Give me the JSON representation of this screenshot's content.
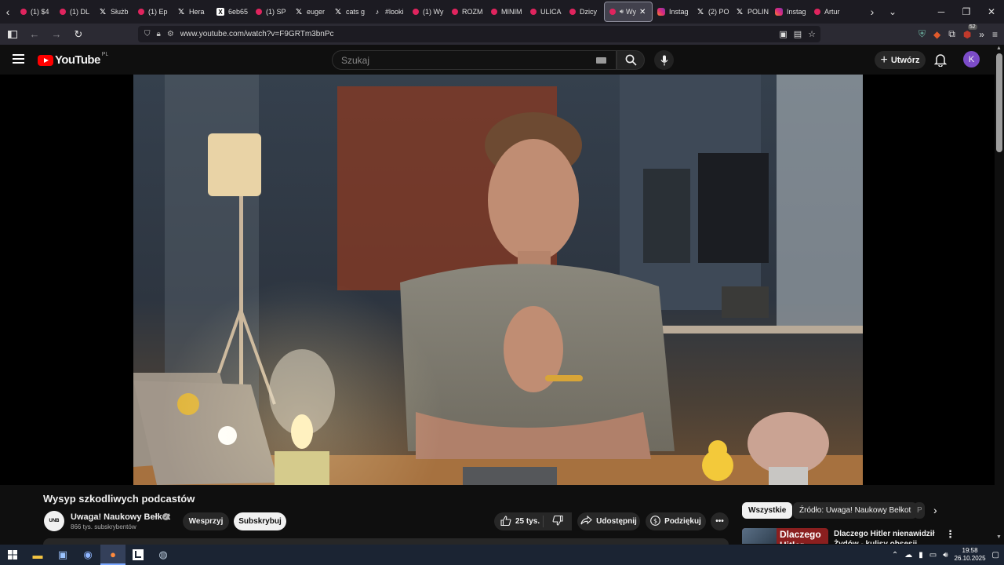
{
  "browser": {
    "tabs": [
      {
        "label": "(1) $4",
        "icon": "yt"
      },
      {
        "label": "(1) DL",
        "icon": "yt"
      },
      {
        "label": "Służb",
        "icon": "x"
      },
      {
        "label": "(1) Ep",
        "icon": "yt"
      },
      {
        "label": "Hera",
        "icon": "x"
      },
      {
        "label": "6eb65",
        "icon": "xbox"
      },
      {
        "label": "(1) SP",
        "icon": "yt"
      },
      {
        "label": "euger",
        "icon": "x"
      },
      {
        "label": "cats g",
        "icon": "x"
      },
      {
        "label": "#looki",
        "icon": "tt"
      },
      {
        "label": "(1) Wy",
        "icon": "yt"
      },
      {
        "label": "ROZM",
        "icon": "yt"
      },
      {
        "label": "MINIM",
        "icon": "yt"
      },
      {
        "label": "ULICA",
        "icon": "yt"
      },
      {
        "label": "Dzicy",
        "icon": "yt"
      },
      {
        "label": "Wy",
        "icon": "yt",
        "active": true
      },
      {
        "label": "Instag",
        "icon": "ig"
      },
      {
        "label": "(2) PO",
        "icon": "x"
      },
      {
        "label": "POLIN",
        "icon": "x"
      },
      {
        "label": "Instag",
        "icon": "ig"
      },
      {
        "label": "Artur",
        "icon": "yt"
      }
    ],
    "url": "www.youtube.com/watch?v=F9GRTm3bnPc",
    "extension_count": "52"
  },
  "youtube": {
    "logo_text": "YouTube",
    "region": "PL",
    "search_placeholder": "Szukaj",
    "create_label": "Utwórz",
    "avatar_letter": "K"
  },
  "video": {
    "title": "Wysyp szkodliwych podcastów",
    "channel": {
      "name": "Uwaga! Naukowy Bełkot",
      "avatar_text": "UNB",
      "subscribers": "866 tys. subskrybentów"
    },
    "buttons": {
      "support": "Wesprzyj",
      "subscribe": "Subskrybuj",
      "likes": "25 tys.",
      "share": "Udostępnij",
      "thanks": "Podziękuj"
    }
  },
  "sidebar": {
    "chips": [
      "Wszystkie",
      "Źródło: Uwaga! Naukowy Bełkot",
      "P"
    ],
    "recommendation": {
      "thumb_text": "Dlaczego Hitler",
      "title": "Dlaczego Hitler nienawidził Żydów - kulisy obsesji"
    }
  },
  "taskbar": {
    "time": "19:58",
    "date": "26.10.2025"
  }
}
